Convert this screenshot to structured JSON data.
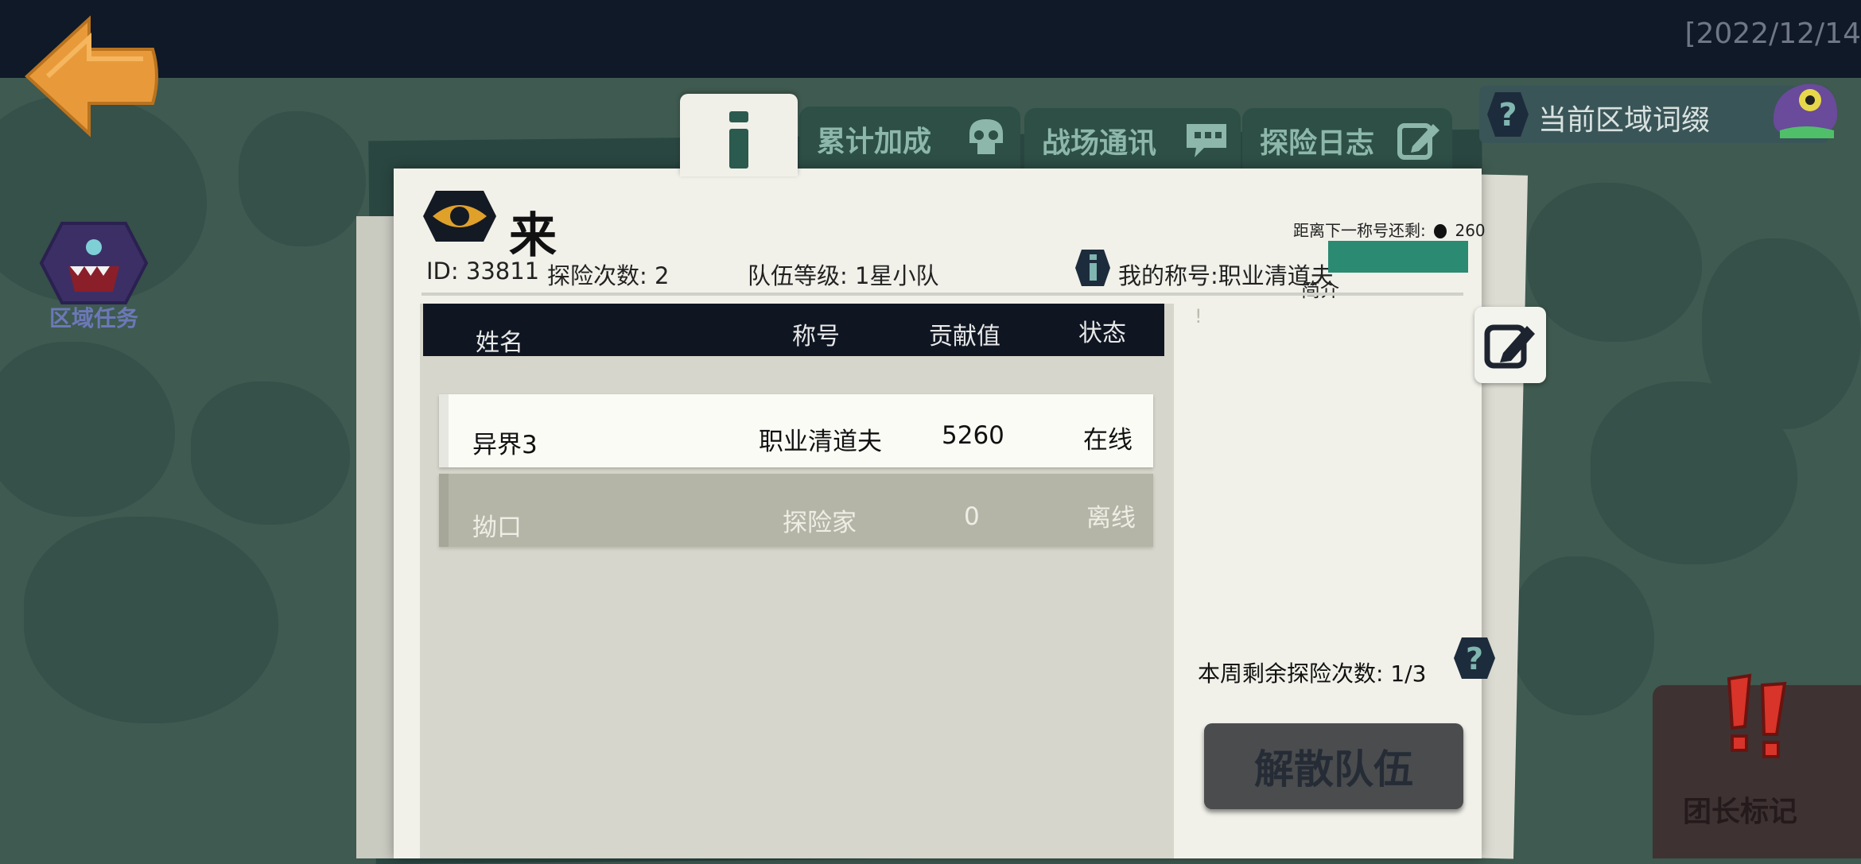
{
  "timestamp": "[2022/12/14",
  "nav": {
    "back_icon": "back-arrow-icon",
    "region_task_label": "区域任务",
    "region_task_icon": "monster-icon"
  },
  "tabs": [
    {
      "label": "",
      "icon": "info-icon",
      "active": true
    },
    {
      "label": "累计加成",
      "icon": "skull-icon"
    },
    {
      "label": "战场通讯",
      "icon": "chat-icon"
    },
    {
      "label": "探险日志",
      "icon": "edit-icon"
    }
  ],
  "region_affix": {
    "label": "当前区域词缀",
    "icon": "question-icon",
    "mascot_icon": "creature-icon"
  },
  "team": {
    "name": "来",
    "id_text": "ID: 33811",
    "explore_count": "探险次数: 2",
    "team_level": "队伍等级: 1星小队",
    "my_title": "我的称号:职业清道夫",
    "next_title_label": "距离下一称号还剩:",
    "next_title_value": "260",
    "intro_label": "简介",
    "exclamation": "!"
  },
  "table": {
    "headers": [
      "姓名",
      "称号",
      "贡献值",
      "状态"
    ],
    "rows": [
      {
        "name": "异界3",
        "title": "职业清道夫",
        "contribution": "5260",
        "status": "在线"
      },
      {
        "name": "拗口",
        "title": "探险家",
        "contribution": "0",
        "status": "离线"
      }
    ]
  },
  "weekly_remaining": "本周剩余探险次数:  1/3",
  "disband_label": "解散队伍",
  "leader_mark_label": "团长标记",
  "colors": {
    "accent_green": "#2b8a72",
    "header_dark": "#0f1622",
    "tab_green": "#2d4f45",
    "back_orange": "#e89a3a"
  }
}
